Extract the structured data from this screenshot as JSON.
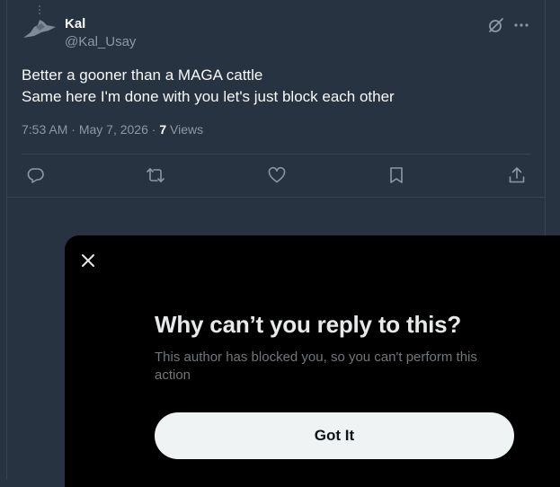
{
  "post": {
    "author": {
      "name": "Kal",
      "handle": "@Kal_Usay",
      "avatar_icon": "avatar-silhouette-icon"
    },
    "text_lines": [
      "Better a gooner than a MAGA cattle",
      "Same here I'm done with you let's just block each other"
    ],
    "time": "7:53 AM",
    "separator": " · ",
    "date": "May 7, 2026",
    "view_count": "7",
    "views_label": "Views",
    "header_icons": [
      "grok-icon",
      "more-icon"
    ],
    "actions": [
      "reply-icon",
      "repost-icon",
      "like-icon",
      "bookmark-icon",
      "share-icon"
    ]
  },
  "modal": {
    "close_icon": "close-icon",
    "title": "Why can’t you reply to this?",
    "text": "This author has blocked you, so you can't perform this action",
    "button_label": "Got It"
  },
  "colors": {
    "background": "#273340",
    "border": "#38444d",
    "text_primary": "#f7f9f9",
    "text_secondary": "#8b98a5",
    "modal_background": "#000000",
    "button_background": "#eff3f4"
  }
}
